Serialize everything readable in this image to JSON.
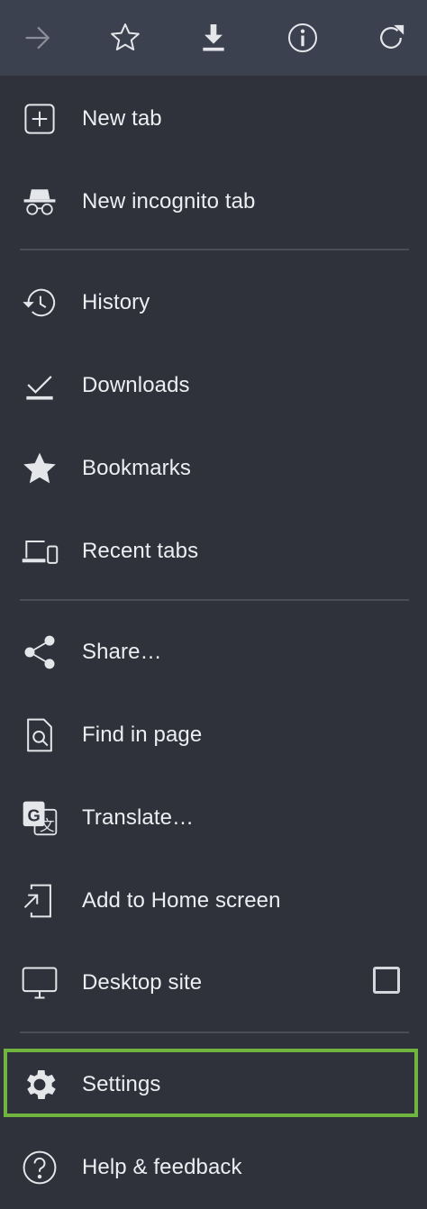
{
  "toolbar": {
    "buttons": [
      {
        "icon": "forward-arrow-icon",
        "enabled": false
      },
      {
        "icon": "star-outline-icon",
        "enabled": true
      },
      {
        "icon": "download-icon",
        "enabled": true
      },
      {
        "icon": "info-icon",
        "enabled": true
      },
      {
        "icon": "reload-icon",
        "enabled": true
      }
    ]
  },
  "menu": {
    "new_tab": "New tab",
    "new_incognito_tab": "New incognito tab",
    "history": "History",
    "downloads": "Downloads",
    "bookmarks": "Bookmarks",
    "recent_tabs": "Recent tabs",
    "share": "Share…",
    "find_in_page": "Find in page",
    "translate": "Translate…",
    "add_to_home_screen": "Add to Home screen",
    "desktop_site": "Desktop site",
    "desktop_site_checked": false,
    "settings": "Settings",
    "help_feedback": "Help & feedback"
  },
  "colors": {
    "background": "#2f313b",
    "toolbar": "#3c4150",
    "text": "#eceef2",
    "icon": "#e4e6ea",
    "disabled_icon": "#8a8e98",
    "highlight": "#6fb53f"
  }
}
